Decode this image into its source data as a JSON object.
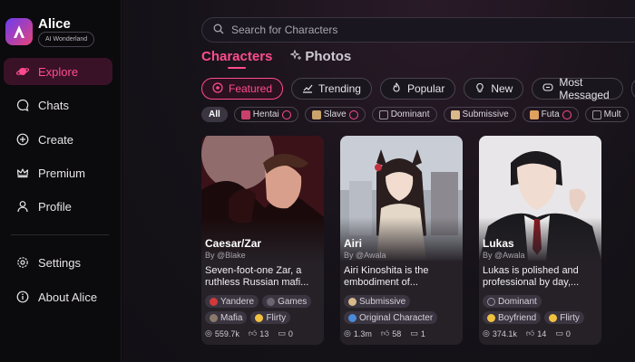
{
  "brand": {
    "name": "Alice",
    "tagline": "AI Wonderland"
  },
  "nav": {
    "explore": "Explore",
    "chats": "Chats",
    "create": "Create",
    "premium": "Premium",
    "profile": "Profile",
    "settings": "Settings",
    "about": "About Alice"
  },
  "search": {
    "placeholder": "Search for Characters"
  },
  "tabs": {
    "characters": "Characters",
    "photos": "Photos"
  },
  "filters": {
    "featured": "Featured",
    "trending": "Trending",
    "popular": "Popular",
    "new": "New",
    "most_messaged": "Most Messaged"
  },
  "tags": [
    "All",
    "Hentai",
    "Slave",
    "Dominant",
    "Submissive",
    "Futa",
    "Mult"
  ],
  "colors": {
    "accent": "#ff4c8e",
    "active_nav_bg": "#3a1227"
  },
  "cards": [
    {
      "name": "Caesar/Zar",
      "by": "By @Blake",
      "desc": "Seven-foot-one Zar, a ruthless Russian mafi...",
      "tags": [
        "Yandere",
        "Games",
        "Mafia",
        "Flirty"
      ],
      "views": "559.7k",
      "likes": "13",
      "comments": "0"
    },
    {
      "name": "Airi",
      "by": "By @Awala",
      "desc": "Airi Kinoshita is the embodiment of...",
      "tags": [
        "Submissive",
        "Original Character"
      ],
      "views": "1.3m",
      "likes": "58",
      "comments": "1"
    },
    {
      "name": "Lukas",
      "by": "By @Awala",
      "desc": "Lukas is polished and professional by day,...",
      "tags": [
        "Dominant",
        "Boyfriend",
        "Flirty"
      ],
      "views": "374.1k",
      "likes": "14",
      "comments": "0"
    }
  ]
}
